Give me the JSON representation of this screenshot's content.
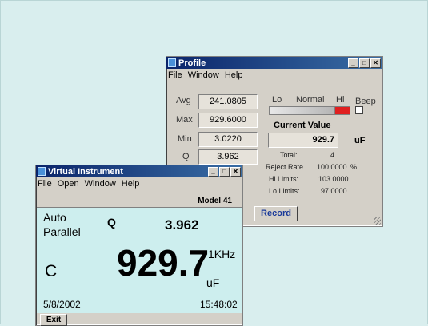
{
  "profile": {
    "title": "Profile",
    "menu": [
      "File",
      "Window",
      "Help"
    ],
    "stats": [
      {
        "label": "Avg",
        "value": "241.0805"
      },
      {
        "label": "Max",
        "value": "929.6000"
      },
      {
        "label": "Min",
        "value": "3.0220"
      },
      {
        "label": "Q",
        "value": "3.962"
      }
    ],
    "gauge": {
      "lo": "Lo",
      "normal": "Normal",
      "hi": "Hi"
    },
    "beep_label": "Beep",
    "current_value_label": "Current Value",
    "current_value": "929.7",
    "unit": "uF",
    "total_label": "Total:",
    "total": "4",
    "reject_rate_label": "Reject Rate",
    "reject_rate": "100.0000",
    "percent": "%",
    "hi_limits_label": "Hi Limits:",
    "hi_limits": "103.0000",
    "lo_limits_label": "Lo Limits:",
    "lo_limits": "97.0000",
    "record_label": "Record"
  },
  "vi": {
    "title": "Virtual Instrument",
    "menu": [
      "File",
      "Open",
      "Window",
      "Help"
    ],
    "model": "Model 41",
    "mode_line1": "Auto",
    "mode_line2": "Parallel",
    "param_label": "Q",
    "param_value": "3.962",
    "measure_label": "C",
    "measure_value": "929.7",
    "frequency": "1KHz",
    "unit": "uF",
    "date": "5/8/2002",
    "time": "15:48:02",
    "exit_label": "Exit"
  },
  "colors": {
    "title_bar": "#0a246a",
    "display_bg": "#cdeeee",
    "hi_indicator": "#e02020"
  }
}
